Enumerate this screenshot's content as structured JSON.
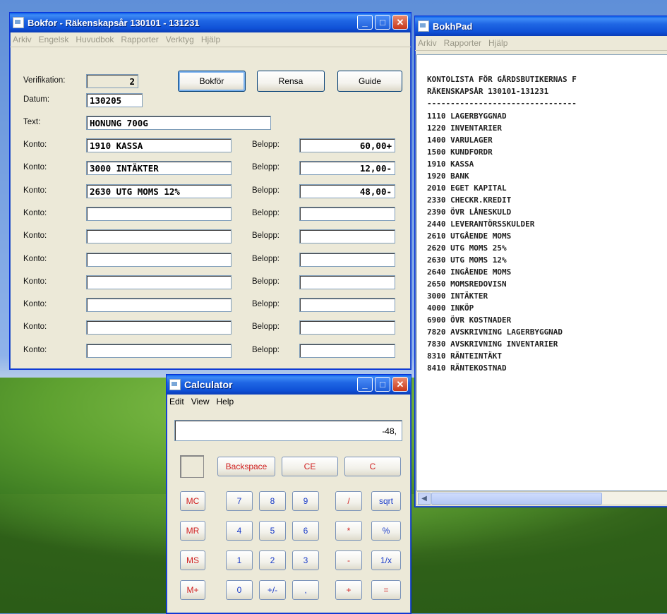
{
  "bokfor": {
    "title": "Bokfor - Räkenskapsår 130101 - 131231",
    "menu": [
      "Arkiv",
      "Engelsk",
      "Huvudbok",
      "Rapporter",
      "Verktyg",
      "Hjälp"
    ],
    "labels": {
      "verifikation": "Verifikation:",
      "datum": "Datum:",
      "text": "Text:",
      "konto": "Konto:",
      "belopp": "Belopp:"
    },
    "verifikation": "2",
    "datum": "130205",
    "text": "HONUNG 700G",
    "buttons": {
      "bokfor": "Bokför",
      "rensa": "Rensa",
      "guide": "Guide"
    },
    "rows": [
      {
        "konto": "1910 KASSA",
        "belopp": "60,00+"
      },
      {
        "konto": "3000 INTÄKTER",
        "belopp": "12,00-"
      },
      {
        "konto": "2630 UTG MOMS 12%",
        "belopp": "48,00-"
      },
      {
        "konto": "",
        "belopp": ""
      },
      {
        "konto": "",
        "belopp": ""
      },
      {
        "konto": "",
        "belopp": ""
      },
      {
        "konto": "",
        "belopp": ""
      },
      {
        "konto": "",
        "belopp": ""
      },
      {
        "konto": "",
        "belopp": ""
      },
      {
        "konto": "",
        "belopp": ""
      }
    ]
  },
  "pad": {
    "title": "BokhPad",
    "menu": [
      "Arkiv",
      "Rapporter",
      "Hjälp"
    ],
    "header1": "KONTOLISTA FÖR GÅRDSBUTIKERNAS F",
    "header2": "RÄKENSKAPSÅR 130101-131231",
    "separator": "--------------------------------",
    "accounts": [
      "1110 LAGERBYGGNAD",
      "1220 INVENTARIER",
      "1400 VARULAGER",
      "1500 KUNDFORDR",
      "1910 KASSA",
      "1920 BANK",
      "2010 EGET KAPITAL",
      "2330 CHECKR.KREDIT",
      "2390 ÖVR LÅNESKULD",
      "2440 LEVERANTÖRSSKULDER",
      "2610 UTGÅENDE MOMS",
      "2620 UTG MOMS 25%",
      "2630 UTG MOMS 12%",
      "2640 INGÅENDE MOMS",
      "2650 MOMSREDOVISN",
      "3000 INTÄKTER",
      "4000 INKÖP",
      "6900 ÖVR KOSTNADER",
      "7820 AVSKRIVNING LAGERBYGGNAD",
      "7830 AVSKRIVNING INVENTARIER",
      "8310 RÄNTEINTÄKT",
      "8410 RÄNTEKOSTNAD"
    ]
  },
  "calc": {
    "title": "Calculator",
    "menu": [
      "Edit",
      "View",
      "Help"
    ],
    "display": "-48,",
    "buttons": {
      "backspace": "Backspace",
      "ce": "CE",
      "c": "C",
      "mc": "MC",
      "mr": "MR",
      "ms": "MS",
      "mplus": "M+",
      "n7": "7",
      "n8": "8",
      "n9": "9",
      "div": "/",
      "sqrt": "sqrt",
      "n4": "4",
      "n5": "5",
      "n6": "6",
      "mul": "*",
      "pct": "%",
      "n1": "1",
      "n2": "2",
      "n3": "3",
      "sub": "-",
      "inv": "1/x",
      "n0": "0",
      "sign": "+/-",
      "dot": ",",
      "add": "+",
      "eq": "="
    }
  },
  "icons": {
    "minimize": "minimize-icon",
    "maximize": "maximize-icon",
    "close": "close-icon"
  }
}
